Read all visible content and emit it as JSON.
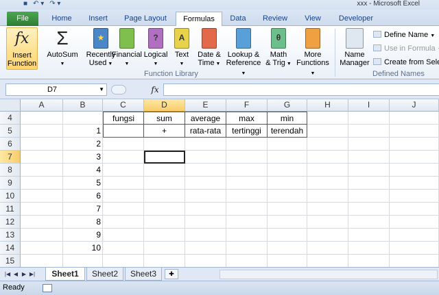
{
  "window": {
    "title": "xxx - Microsoft Excel"
  },
  "quick_access": {
    "save_icon": "save-icon",
    "undo_icon": "undo-icon",
    "redo_icon": "redo-icon"
  },
  "ribbon": {
    "tabs": [
      "File",
      "Home",
      "Insert",
      "Page Layout",
      "Formulas",
      "Data",
      "Review",
      "View",
      "Developer"
    ],
    "active_tab": "Formulas",
    "function_library": {
      "group_label": "Function Library",
      "insert_function": {
        "line1": "Insert",
        "line2": "Function",
        "glyph": "fx"
      },
      "autosum": {
        "label": "AutoSum",
        "glyph": "Σ"
      },
      "recently_used": {
        "line1": "Recently",
        "line2": "Used"
      },
      "financial": {
        "label": "Financial",
        "color": "#7fbf4d"
      },
      "logical": {
        "label": "Logical",
        "color": "#b06fc0",
        "glyph": "?"
      },
      "text": {
        "label": "Text",
        "color": "#e8d24a",
        "glyph": "A"
      },
      "date_time": {
        "line1": "Date &",
        "line2": "Time",
        "color": "#e26a4a"
      },
      "lookup": {
        "line1": "Lookup &",
        "line2": "Reference",
        "color": "#5aa0d8"
      },
      "math": {
        "line1": "Math",
        "line2": "& Trig",
        "color": "#6cbf8a",
        "glyph": "θ"
      },
      "more": {
        "line1": "More",
        "line2": "Functions",
        "color": "#f0a040"
      }
    },
    "defined_names": {
      "group_label": "Defined Names",
      "name_manager": {
        "line1": "Name",
        "line2": "Manager"
      },
      "define_name": "Define Name",
      "use_in_formula": "Use in Formula",
      "create_from_selection": "Create from Sele"
    }
  },
  "formula_bar": {
    "name_box": "D7",
    "fx": "fx",
    "formula": ""
  },
  "grid": {
    "columns": [
      "A",
      "B",
      "C",
      "D",
      "E",
      "F",
      "G",
      "H",
      "I",
      "J"
    ],
    "selected_column": "D",
    "rows": [
      "4",
      "5",
      "6",
      "7",
      "8",
      "9",
      "10",
      "11",
      "12",
      "13",
      "14",
      "15"
    ],
    "selected_row": "7",
    "active_cell": "D7",
    "cells": {
      "C4": "fungsi",
      "D4": "sum",
      "E4": "average",
      "F4": "max",
      "G4": "min",
      "B5": "1",
      "D5": "+",
      "E5": "rata-rata",
      "F5": "tertinggi",
      "G5": "terendah",
      "B6": "2",
      "B7": "3",
      "B8": "4",
      "B9": "5",
      "B10": "6",
      "B11": "7",
      "B12": "8",
      "B13": "9",
      "B14": "10"
    }
  },
  "sheets": {
    "tabs": [
      "Sheet1",
      "Sheet2",
      "Sheet3"
    ],
    "active": "Sheet1"
  },
  "status": {
    "text": "Ready"
  }
}
